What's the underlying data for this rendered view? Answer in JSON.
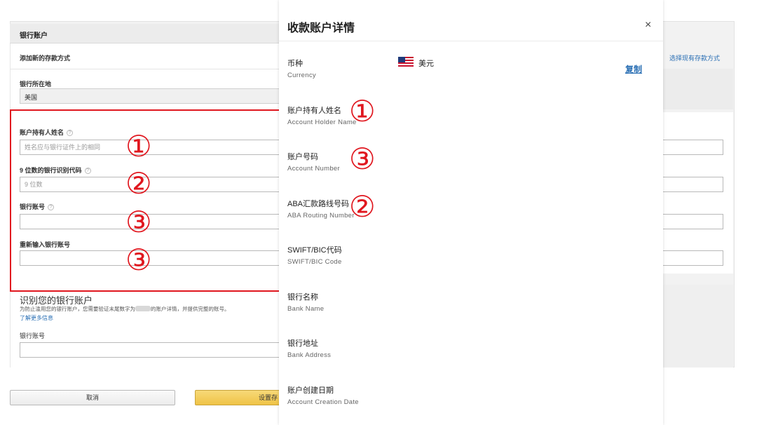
{
  "form": {
    "header_title": "银行账户",
    "subheader": "添加新的存款方式",
    "country_label": "银行所在地",
    "country_value": "美国",
    "holder_label": "账户持有人姓名",
    "holder_placeholder": "姓名应与银行证件上的相同",
    "routing_label": "9 位数的银行识别代码",
    "routing_placeholder": "9 位数",
    "account_label": "银行账号",
    "reenter_label": "重新输入银行账号",
    "identify_title": "识别您的银行账户",
    "identify_desc_pre": "为防止滥用您的银行账户，您需要验证末尾数字为",
    "identify_desc_post": "的账户详情，并提供完整的账号。",
    "learn_more": "了解更多信息",
    "bank_account_label": "银行账号",
    "cancel_label": "取消",
    "set_label": "设置存",
    "choose_existing": "选择现有存款方式"
  },
  "annotations": {
    "one": "①",
    "two": "②",
    "three": "③"
  },
  "modal": {
    "title": "收款账户详情",
    "close": "×",
    "copy": "复制",
    "currency_value": "美元",
    "fields": [
      {
        "cn": "币种",
        "en": "Currency"
      },
      {
        "cn": "账户持有人姓名",
        "en": "Account Holder Name"
      },
      {
        "cn": "账户号码",
        "en": "Account Number"
      },
      {
        "cn": "ABA汇款路线号码",
        "en": "ABA Routing Number"
      },
      {
        "cn": "SWIFT/BIC代码",
        "en": "SWIFT/BIC Code"
      },
      {
        "cn": "银行名称",
        "en": "Bank Name"
      },
      {
        "cn": "银行地址",
        "en": "Bank Address"
      },
      {
        "cn": "账户创建日期",
        "en": "Account Creation Date"
      }
    ]
  },
  "colors": {
    "annotation_red": "#e0171f",
    "link_blue": "#2a6fb4",
    "primary_button": "#efc346"
  }
}
